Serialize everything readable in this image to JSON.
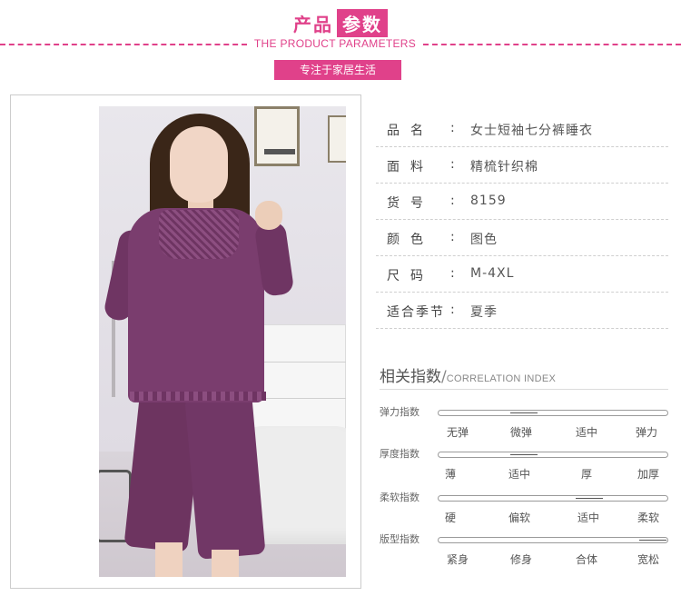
{
  "header": {
    "title_main": "产品",
    "title_highlight": "参数",
    "subtitle": "THE PRODUCT PARAMETERS",
    "tag": "专注于家居生活"
  },
  "photo": {
    "alt": "model wearing purple short-sleeve top and cropped pants"
  },
  "params": [
    {
      "label": "品名",
      "value": "女士短袖七分裤睡衣"
    },
    {
      "label": "面料",
      "value": "精梳针织棉"
    },
    {
      "label": "货号",
      "value": "8159"
    },
    {
      "label": "颜色",
      "value": "图色"
    },
    {
      "label": "尺码",
      "value": "M-4XL"
    },
    {
      "label": "适合季节",
      "value": "夏季"
    }
  ],
  "index": {
    "title": "相关指数",
    "slash": "/",
    "subtitle": "CORRELATION INDEX",
    "rows": [
      {
        "label": "弹力指数",
        "options": [
          "无弹",
          "微弹",
          "适中",
          "弹力"
        ],
        "selected": 1
      },
      {
        "label": "厚度指数",
        "options": [
          "薄",
          "适中",
          "厚",
          "加厚"
        ],
        "selected": 1
      },
      {
        "label": "柔软指数",
        "options": [
          "硬",
          "偏软",
          "适中",
          "柔软"
        ],
        "selected": 2
      },
      {
        "label": "版型指数",
        "options": [
          "紧身",
          "修身",
          "合体",
          "宽松"
        ],
        "selected": 3
      }
    ]
  },
  "colors": {
    "accent": "#e0418a",
    "top": "#7a3d6e"
  }
}
